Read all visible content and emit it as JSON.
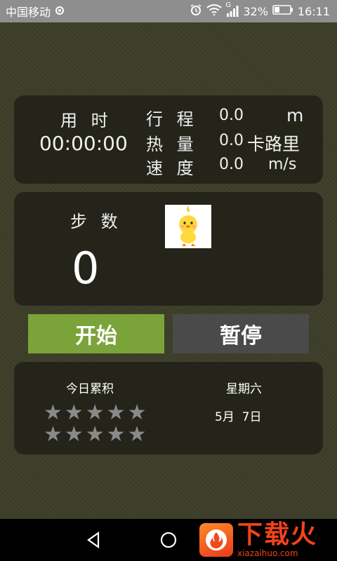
{
  "status_bar": {
    "carrier": "中国移动",
    "signal_type": "G",
    "battery": "32%",
    "time": "16:11"
  },
  "summary": {
    "time_label": "用 时",
    "time_value": "00:00:00",
    "distance_label": "行 程",
    "distance_value": "0.0",
    "distance_unit": "m",
    "calories_label": "热 量",
    "calories_value": "0.0",
    "calories_unit": "卡路里",
    "speed_label": "速 度",
    "speed_value": "0.0",
    "speed_unit": "m/s"
  },
  "steps": {
    "label": "步 数",
    "value": "0"
  },
  "buttons": {
    "start": "开始",
    "pause": "暂停"
  },
  "today": {
    "label": "今日累积",
    "weekday": "星期六",
    "date": "5月  7日",
    "star_rows": [
      "★★★★★",
      "★★★★★"
    ]
  },
  "watermark": {
    "name": "下载火",
    "url": "xiazaihuo.com"
  },
  "colors": {
    "accent_green": "#7aa43a",
    "pause_gray": "#4a4a4a",
    "card_bg": "#24241a",
    "app_bg": "#3c3d29"
  }
}
